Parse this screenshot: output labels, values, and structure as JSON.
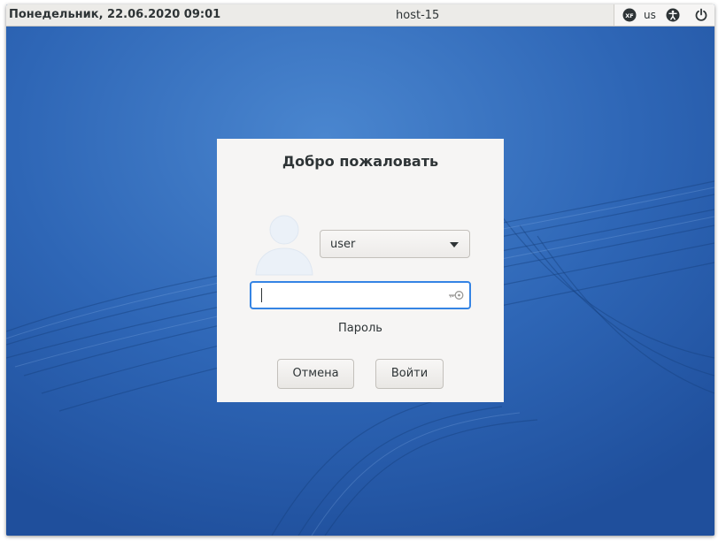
{
  "topbar": {
    "clock": "Понедельник, 22.06.2020 09:01",
    "hostname": "host-15",
    "tray": {
      "status_icon": "xfce-icon",
      "keyboard_layout": "us",
      "accessibility_icon": "accessibility-icon",
      "power_icon": "power-icon"
    }
  },
  "dialog": {
    "title": "Добро пожаловать",
    "user_select": {
      "selected": "user",
      "icon": "chevron-down-icon"
    },
    "password": {
      "value": "",
      "label": "Пароль",
      "icon": "key-icon"
    },
    "buttons": {
      "cancel": "Отмена",
      "login": "Войти"
    }
  },
  "colors": {
    "desktop_background": "#2f68b8",
    "dialog_background": "#f6f5f4",
    "focus_accent": "#3584e4",
    "topbar_background": "#ecebe8"
  }
}
